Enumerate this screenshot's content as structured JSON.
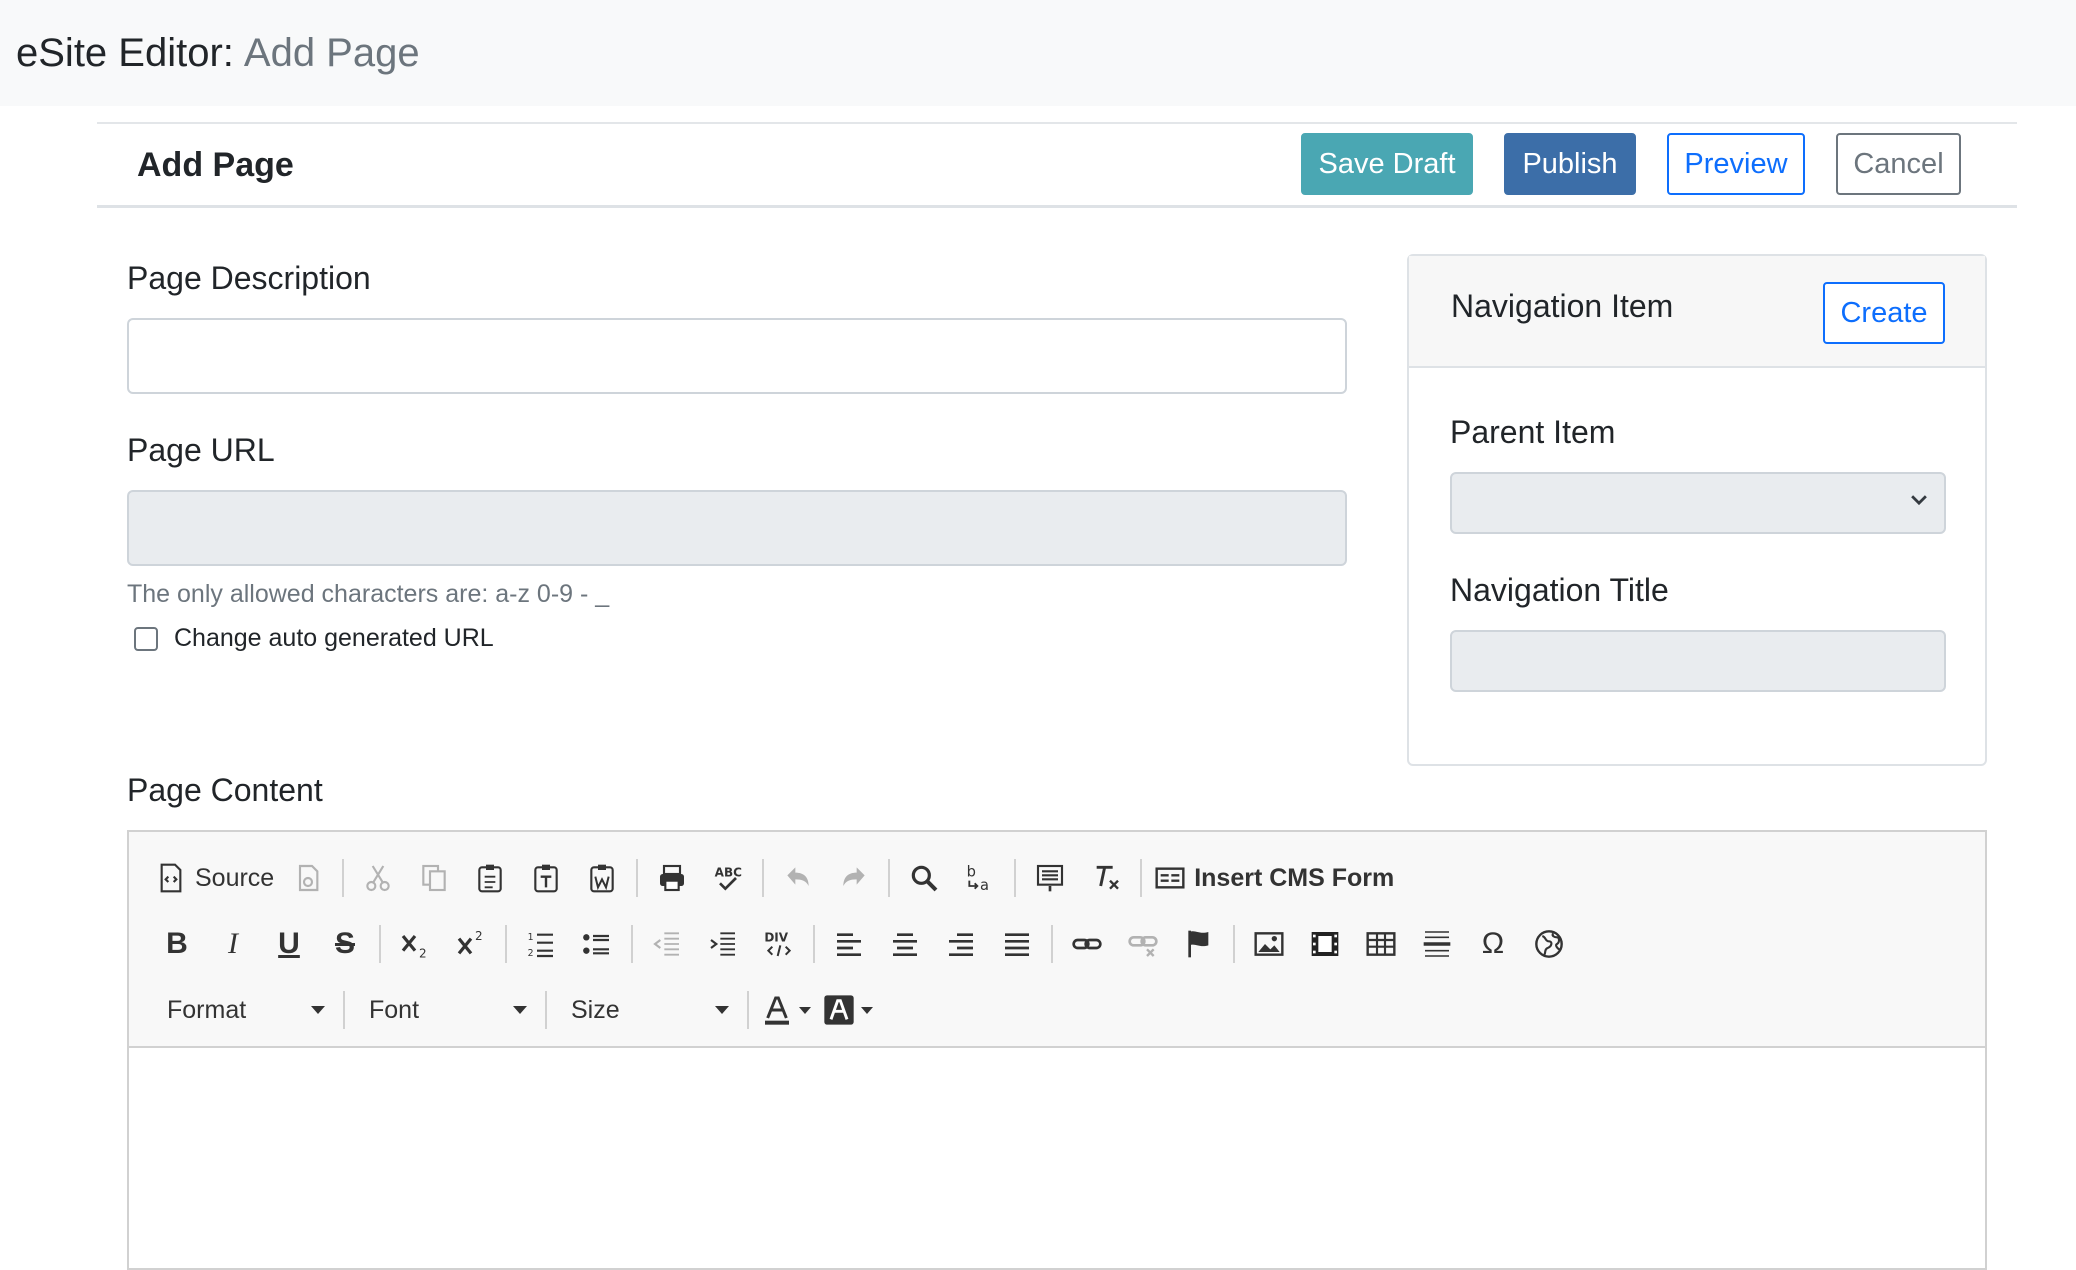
{
  "header": {
    "app_name": "eSite Editor:",
    "page_name": "Add Page"
  },
  "card": {
    "title": "Add Page",
    "actions": {
      "save_draft": "Save Draft",
      "publish": "Publish",
      "preview": "Preview",
      "cancel": "Cancel"
    }
  },
  "form": {
    "description_label": "Page Description",
    "description_value": "",
    "url_label": "Page URL",
    "url_value": "",
    "url_help": "The only allowed characters are: a-z 0-9 - _",
    "change_url_label": "Change auto generated URL",
    "content_label": "Page Content"
  },
  "nav": {
    "title": "Navigation Item",
    "create_label": "Create",
    "parent_label": "Parent Item",
    "parent_value": "",
    "title_label": "Navigation Title",
    "title_value": ""
  },
  "editor": {
    "source_label": "Source",
    "insert_cms_label": "Insert CMS Form",
    "format_label": "Format",
    "font_label": "Font",
    "size_label": "Size",
    "content": ""
  },
  "colors": {
    "save_draft": "#4aa7b3",
    "publish": "#3c6ea8",
    "primary": "#0d6efd",
    "secondary": "#6c757d",
    "header_bg": "#f8f9fa"
  }
}
